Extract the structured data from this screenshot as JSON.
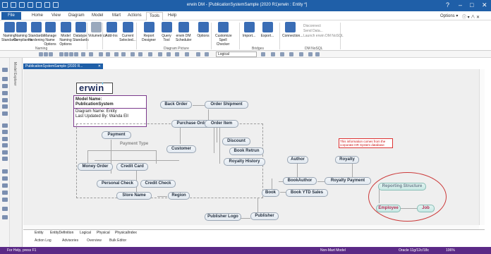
{
  "window": {
    "title": "erwin DM - [PublicationSystemSample (2020 R1)erwin : Entity *]",
    "help_btn": "?",
    "min": "–",
    "max": "□",
    "close": "✕"
  },
  "menu": {
    "file": "File",
    "items": [
      "Home",
      "View",
      "Diagram",
      "Model",
      "Mart",
      "Actions",
      "Tools",
      "Help"
    ],
    "options": "Options ▾",
    "help_icons": "ⓘ ▾ ∧ ✕"
  },
  "ribbon": {
    "buttons": [
      {
        "label": "Naming\nStandards",
        "icon": "naming-standards-icon",
        "color": "#3a6db5"
      },
      {
        "label": "Naming\nCompliance",
        "icon": "naming-compliance-icon",
        "color": "#3a6db5"
      },
      {
        "label": "Standards\nHardening",
        "icon": "standards-hardening-icon",
        "color": "#3a6db5"
      },
      {
        "label": "Manage Name\nOptions",
        "icon": "manage-name-icon",
        "color": "#3a6db5"
      },
      {
        "label": "Model Naming\nOptions",
        "icon": "model-naming-icon",
        "color": "#3a6db5"
      },
      {
        "label": "Datatype\nStandards",
        "icon": "datatype-icon",
        "color": "#3a6db5"
      },
      {
        "label": "Volumetrics",
        "icon": "volumetrics-icon",
        "color": "#9aa9bd"
      },
      {
        "label": "Add-Ins",
        "icon": "addins-icon",
        "color": "#3a6db5"
      },
      {
        "label": "Current Selected...",
        "icon": "current-selected-icon",
        "color": "#3a6db5"
      },
      {
        "label": "Report\nDesigner",
        "icon": "report-designer-icon",
        "color": "#3a6db5"
      },
      {
        "label": "Query\nTool",
        "icon": "query-tool-icon",
        "color": "#3a6db5"
      },
      {
        "label": "erwin DM\nScheduler",
        "icon": "scheduler-icon",
        "color": "#3a6db5"
      },
      {
        "label": "Options",
        "icon": "options-icon",
        "color": "#3a6db5"
      },
      {
        "label": "Customize\nSpell Checker",
        "icon": "spell-checker-icon",
        "color": "#3a6db5"
      },
      {
        "label": "Import...",
        "icon": "import-icon",
        "color": "#3a6db5"
      },
      {
        "label": "Export...",
        "icon": "export-icon",
        "color": "#3a6db5"
      },
      {
        "label": "Connection...",
        "icon": "connection-icon",
        "color": "#3a6db5"
      }
    ],
    "groups": [
      "Naming",
      "Diagram Picture",
      "Bridges",
      "DM NoSQL"
    ],
    "small": [
      "Disconnect",
      "Send Data...",
      "Launch erwin DM NoSQL"
    ]
  },
  "toolbar": {
    "font": "Logical"
  },
  "explorer": {
    "label": "Model Explorer"
  },
  "doc_tab": {
    "label": "PublicationSystemSample (2020 R...",
    "close": "✕"
  },
  "erwin": {
    "logo": "erwin",
    "model_name_label": "Model Name:",
    "model_name": "PublicationSystem",
    "diagram_name": "Diagram Name:   Entity",
    "last_updated": "Last Updated By:    Wanda Ell"
  },
  "entities": {
    "back_order": "Back Order",
    "order_shipment": "Order Shipment",
    "purchase_order": "Purchase Order",
    "order_item": "Order Item",
    "payment": "Payment",
    "payment_type": "Payment Type",
    "customer": "Customer",
    "discount": "Discount",
    "book_return": "Book Retrun",
    "royalty_history": "Royalty History",
    "money_order": "Money Order",
    "credit_card": "Credit Card",
    "personal_check": "Personal Check",
    "credit_check": "Credit Check",
    "store_name": "Store Name",
    "region": "Region",
    "author": "Author",
    "royalty": "Royalty",
    "book_author": "BookAuthor",
    "royalty_payment": "Royalty Payment",
    "book": "Book",
    "book_ytd_sales": "Book YTD Sales",
    "publisher_logo": "Publisher Logo",
    "publisher": "Publisher",
    "reporting_structure": "Reporting Structure",
    "employee": "Employee",
    "job": "Job"
  },
  "note": "This information comes from the corporate HR System database",
  "sheets": [
    "Entity",
    "EntityDefinition",
    "Logical",
    "Physical",
    "PhysicalIndex"
  ],
  "bottom_panel": [
    "Action Log",
    "Advisories",
    "Overview",
    "Bulk Editor"
  ],
  "status": {
    "left": "For Help, press F1",
    "model": "Non-Mart Model",
    "db": "Oracle 11g/12c/18c",
    "zoom": "106%"
  }
}
